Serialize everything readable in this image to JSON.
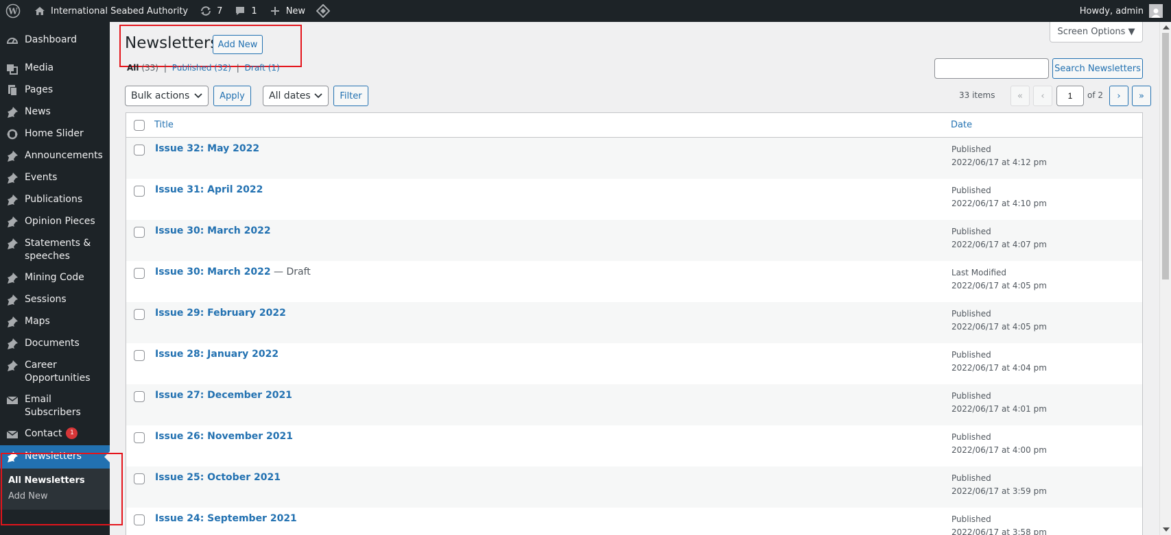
{
  "adminbar": {
    "site_name": "International Seabed Authority",
    "updates_count": "7",
    "comments_count": "1",
    "new_label": "New",
    "greeting": "Howdy, admin"
  },
  "sidebar": {
    "items": [
      {
        "label": "Dashboard",
        "icon": "dashboard-icon"
      },
      {
        "label": "Media",
        "icon": "media-icon"
      },
      {
        "label": "Pages",
        "icon": "pages-icon"
      },
      {
        "label": "News",
        "icon": "pin-icon"
      },
      {
        "label": "Home Slider",
        "icon": "slider-icon"
      },
      {
        "label": "Announcements",
        "icon": "pin-icon"
      },
      {
        "label": "Events",
        "icon": "pin-icon"
      },
      {
        "label": "Publications",
        "icon": "pin-icon"
      },
      {
        "label": "Opinion Pieces",
        "icon": "pin-icon"
      },
      {
        "label": "Statements & speeches",
        "icon": "pin-icon"
      },
      {
        "label": "Mining Code",
        "icon": "pin-icon"
      },
      {
        "label": "Sessions",
        "icon": "pin-icon"
      },
      {
        "label": "Maps",
        "icon": "pin-icon"
      },
      {
        "label": "Documents",
        "icon": "pin-icon"
      },
      {
        "label": "Career Opportunities",
        "icon": "pin-icon"
      },
      {
        "label": "Email Subscribers",
        "icon": "mail-icon"
      },
      {
        "label": "Contact",
        "icon": "mail-icon",
        "badge": "1"
      },
      {
        "label": "Newsletters",
        "icon": "pin-icon",
        "current": true
      }
    ],
    "submenu": [
      {
        "label": "All Newsletters",
        "current": true
      },
      {
        "label": "Add New"
      }
    ]
  },
  "main": {
    "screen_options_label": "Screen Options ▼",
    "page_title": "Newsletters",
    "add_new_label": "Add New",
    "filters": {
      "all_label": "All",
      "all_count": "(33)",
      "published_label": "Published",
      "published_count": "(32)",
      "draft_label": "Draft",
      "draft_count": "(1)",
      "separator": "|"
    },
    "search_button_label": "Search Newsletters",
    "search_value": "",
    "bulk_actions_value": "Bulk actions",
    "apply_label": "Apply",
    "dates_value": "All dates",
    "filter_label": "Filter",
    "pagination": {
      "items_count": "33 items",
      "first": "«",
      "prev": "‹",
      "current_page": "1",
      "of_label": "of 2",
      "next": "›",
      "last": "»"
    },
    "table": {
      "columns": {
        "title": "Title",
        "date": "Date"
      },
      "rows": [
        {
          "title": "Issue 32: May 2022",
          "state": "",
          "status": "Published",
          "date": "2022/06/17 at 4:12 pm"
        },
        {
          "title": "Issue 31: April 2022",
          "state": "",
          "status": "Published",
          "date": "2022/06/17 at 4:10 pm"
        },
        {
          "title": "Issue 30: March 2022",
          "state": "",
          "status": "Published",
          "date": "2022/06/17 at 4:07 pm"
        },
        {
          "title": "Issue 30: March 2022",
          "state": " — Draft",
          "status": "Last Modified",
          "date": "2022/06/17 at 4:05 pm"
        },
        {
          "title": "Issue 29: February 2022",
          "state": "",
          "status": "Published",
          "date": "2022/06/17 at 4:05 pm"
        },
        {
          "title": "Issue 28: January 2022",
          "state": "",
          "status": "Published",
          "date": "2022/06/17 at 4:04 pm"
        },
        {
          "title": "Issue 27: December 2021",
          "state": "",
          "status": "Published",
          "date": "2022/06/17 at 4:01 pm"
        },
        {
          "title": "Issue 26: November 2021",
          "state": "",
          "status": "Published",
          "date": "2022/06/17 at 4:00 pm"
        },
        {
          "title": "Issue 25: October 2021",
          "state": "",
          "status": "Published",
          "date": "2022/06/17 at 3:59 pm"
        },
        {
          "title": "Issue 24: September 2021",
          "state": "",
          "status": "Published",
          "date": "2022/06/17 at 3:58 pm"
        }
      ]
    }
  },
  "colors": {
    "admin_dark": "#1d2327",
    "accent_blue": "#2271b1",
    "highlight_red": "#e4141b",
    "badge_red": "#d63638"
  }
}
